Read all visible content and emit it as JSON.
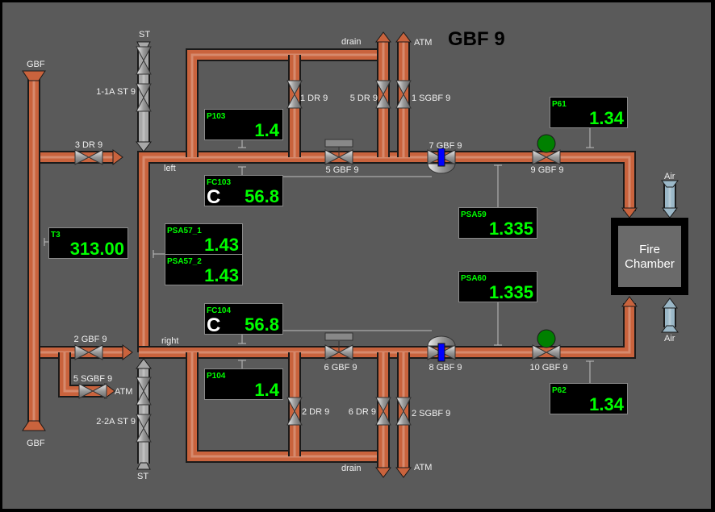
{
  "title": "GBF 9",
  "colors": {
    "background": "#5a5a5a",
    "pipe": "#c9633d",
    "steam_pipe": "#a8a8a8",
    "air_pipe": "#9bb8c8",
    "display_text": "#00ff00",
    "valve_open": "#008000",
    "positioner": "#0000ff"
  },
  "labels": {
    "gbf_top": "GBF",
    "gbf_bottom": "GBF",
    "st_top": "ST",
    "st_bottom": "ST",
    "drain_top": "drain",
    "drain_bottom": "drain",
    "atm_top": "ATM",
    "atm_bottom": "ATM",
    "atm_left": "ATM",
    "left": "left",
    "right": "right",
    "air_top": "Air",
    "air_bottom": "Air"
  },
  "fire_chamber": {
    "line1": "Fire",
    "line2": "Chamber"
  },
  "valves": [
    {
      "label": "3 DR 9"
    },
    {
      "label": "2 GBF 9"
    },
    {
      "label": "5 SGBF 9"
    },
    {
      "label": "1-1A ST 9"
    },
    {
      "label": "2-2A ST 9"
    },
    {
      "label": "1 DR 9"
    },
    {
      "label": "5 DR 9"
    },
    {
      "label": "1 SGBF 9"
    },
    {
      "label": "2 DR 9"
    },
    {
      "label": "6 DR 9"
    },
    {
      "label": "2 SGBF 9"
    },
    {
      "label": "5 GBF 9"
    },
    {
      "label": "7 GBF 9"
    },
    {
      "label": "9 GBF 9"
    },
    {
      "label": "6 GBF 9"
    },
    {
      "label": "8 GBF 9"
    },
    {
      "label": "10 GBF 9"
    }
  ],
  "displays": [
    {
      "tag": "P103",
      "value": "1.4"
    },
    {
      "tag": "FC103",
      "mode": "C",
      "value": "56.8"
    },
    {
      "tag": "T3",
      "value": "313.00"
    },
    {
      "tag": "PSA57_1",
      "value": "1.43"
    },
    {
      "tag": "PSA57_2",
      "value": "1.43"
    },
    {
      "tag": "FC104",
      "mode": "C",
      "value": "56.8"
    },
    {
      "tag": "P104",
      "value": "1.4"
    },
    {
      "tag": "P61",
      "value": "1.34"
    },
    {
      "tag": "PSA59",
      "value": "1.335"
    },
    {
      "tag": "PSA60",
      "value": "1.335"
    },
    {
      "tag": "P62",
      "value": "1.34"
    }
  ]
}
